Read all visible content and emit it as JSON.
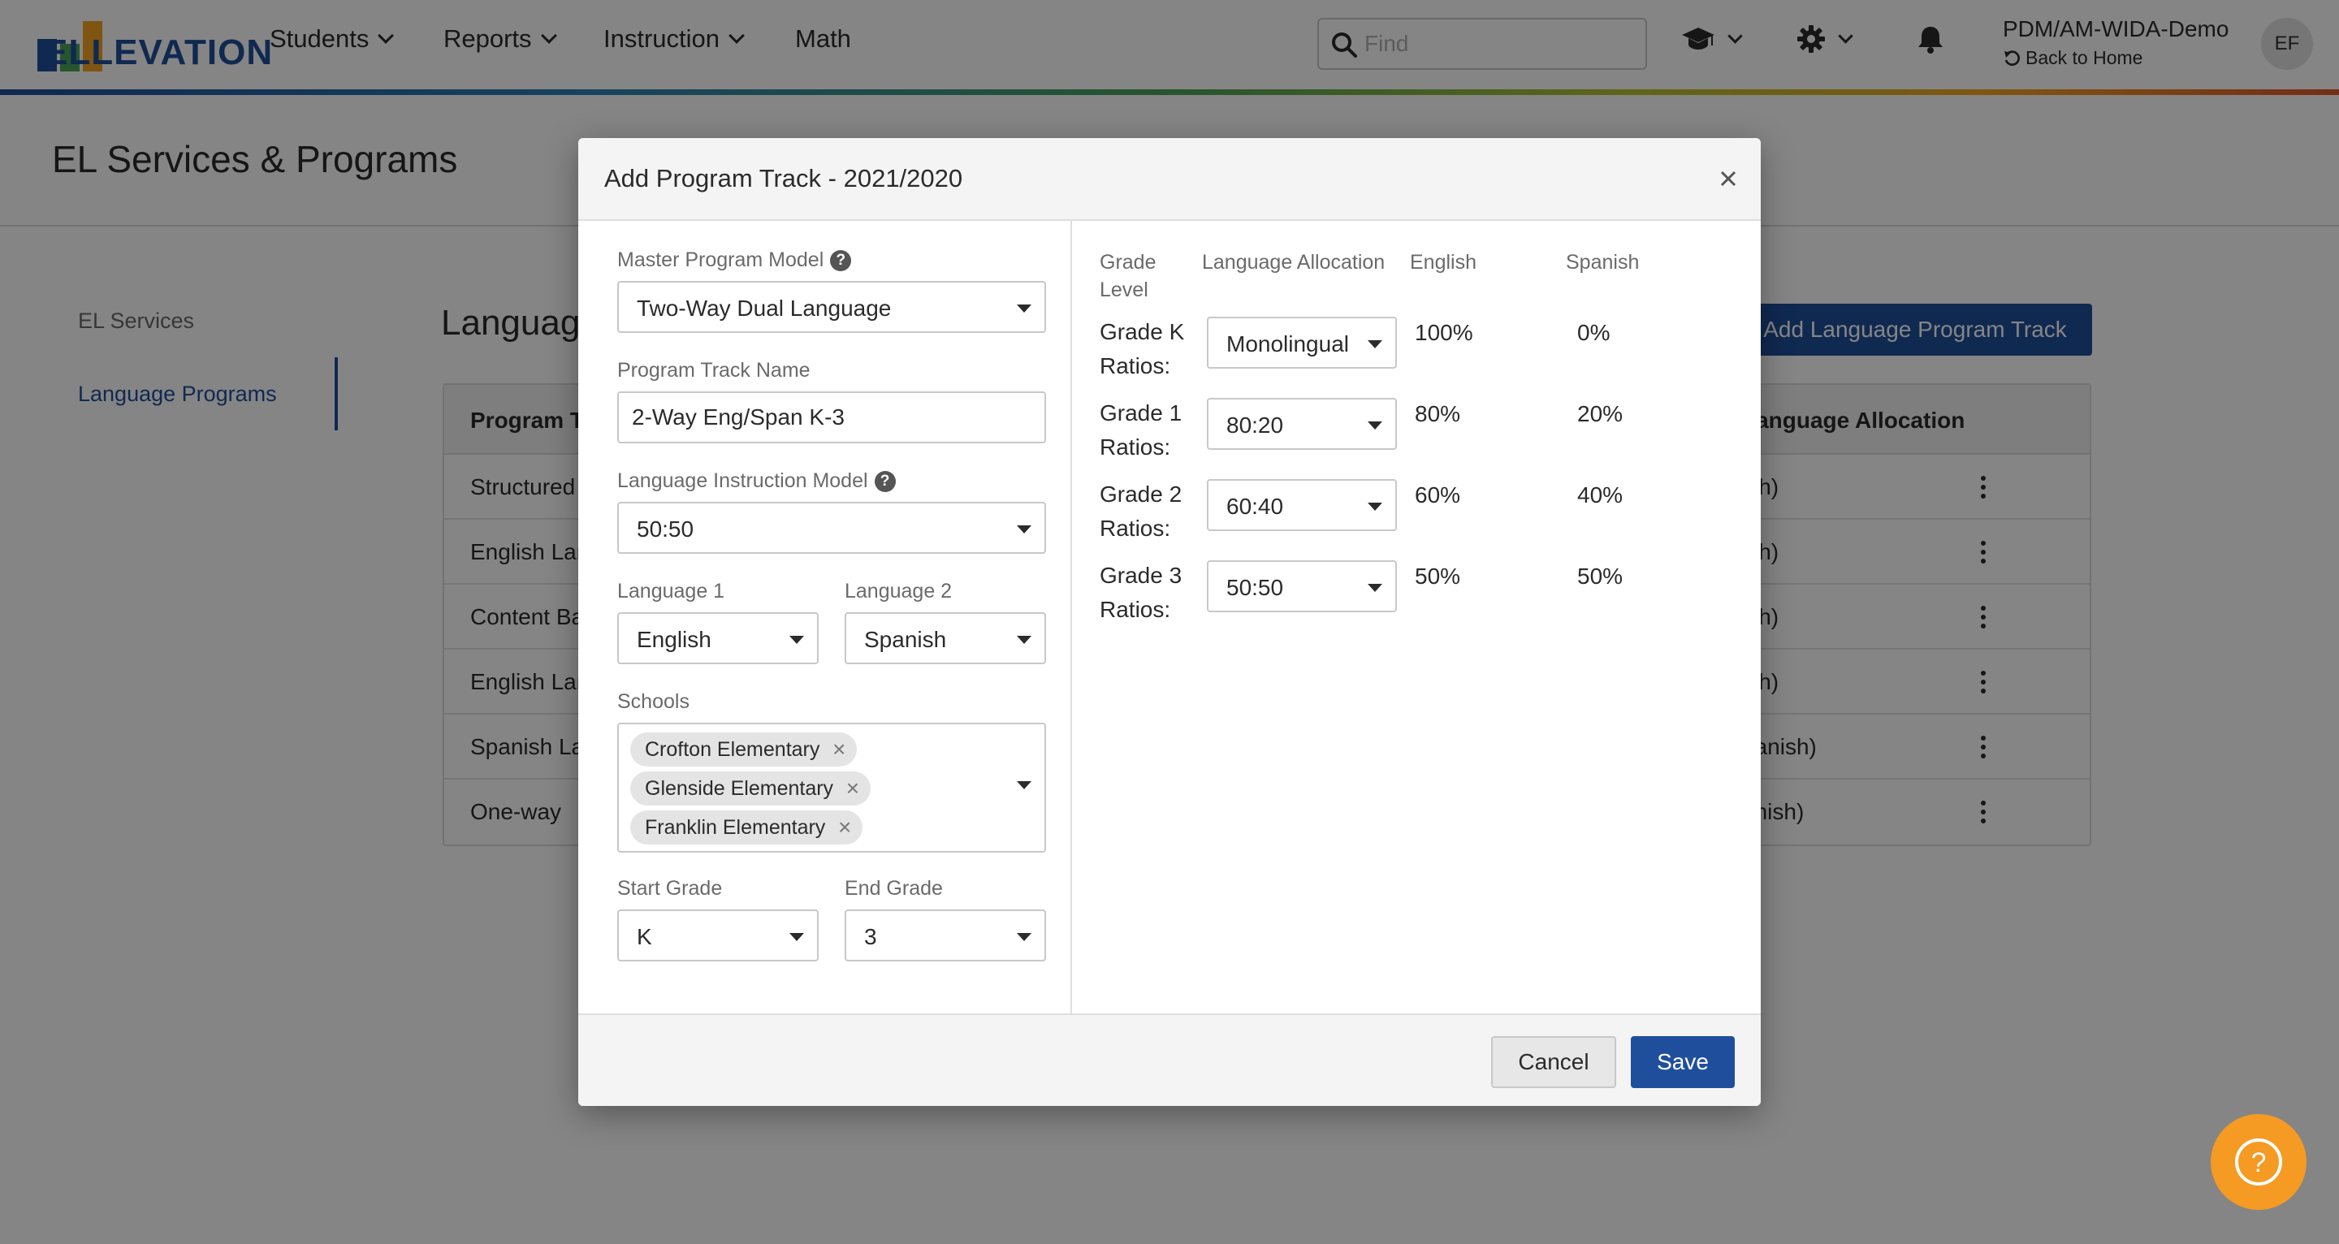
{
  "nav": {
    "logo_text": "ELLEVATION",
    "items": [
      {
        "label": "Students",
        "has_dropdown": true
      },
      {
        "label": "Reports",
        "has_dropdown": true
      },
      {
        "label": "Instruction",
        "has_dropdown": true
      },
      {
        "label": "Math",
        "has_dropdown": false
      }
    ],
    "search_placeholder": "Find",
    "user_org": "PDM/AM-WIDA-Demo",
    "back_home": "Back to Home",
    "avatar_initials": "EF",
    "icons": [
      "search-icon",
      "graduation-cap-icon",
      "gear-icon",
      "bell-icon",
      "undo-icon"
    ]
  },
  "page": {
    "title": "EL Services & Programs",
    "side_nav": [
      {
        "label": "EL Services",
        "active": false
      },
      {
        "label": "Language Programs",
        "active": true
      }
    ],
    "section_title": "Language Programs",
    "add_button": "Add Language Program Track",
    "table": {
      "headers": [
        "Program Track",
        "Language Allocation"
      ],
      "rows": [
        {
          "name": "Structured",
          "alloc": "ish)"
        },
        {
          "name": "English Lan",
          "alloc": "ish)"
        },
        {
          "name": "Content Ba",
          "alloc": "ish)"
        },
        {
          "name": "English Lan",
          "alloc": "ish)"
        },
        {
          "name": "Spanish La",
          "alloc": "panish)"
        },
        {
          "name": "One-way",
          "alloc": "anish)"
        }
      ]
    }
  },
  "modal": {
    "title": "Add Program Track - 2021/2020",
    "master_model_label": "Master Program Model",
    "master_model_value": "Two-Way Dual Language",
    "track_name_label": "Program Track Name",
    "track_name_value": "2-Way Eng/Span K-3",
    "instruction_model_label": "Language Instruction Model",
    "instruction_model_value": "50:50",
    "language1_label": "Language 1",
    "language1_value": "English",
    "language2_label": "Language 2",
    "language2_value": "Spanish",
    "schools_label": "Schools",
    "schools": [
      "Crofton Elementary",
      "Glenside Elementary",
      "Franklin Elementary"
    ],
    "start_grade_label": "Start Grade",
    "start_grade_value": "K",
    "end_grade_label": "End Grade",
    "end_grade_value": "3",
    "ratio_headers": {
      "grade_level": "Grade Level",
      "allocation": "Language Allocation",
      "english": "English",
      "spanish": "Spanish"
    },
    "ratios": [
      {
        "grade": "Grade K",
        "suffix": "Ratios:",
        "allocation": "Monolingual",
        "english": "100%",
        "spanish": "0%"
      },
      {
        "grade": "Grade 1",
        "suffix": "Ratios:",
        "allocation": "80:20",
        "english": "80%",
        "spanish": "20%"
      },
      {
        "grade": "Grade 2",
        "suffix": "Ratios:",
        "allocation": "60:40",
        "english": "60%",
        "spanish": "40%"
      },
      {
        "grade": "Grade 3",
        "suffix": "Ratios:",
        "allocation": "50:50",
        "english": "50%",
        "spanish": "50%"
      }
    ],
    "cancel_label": "Cancel",
    "save_label": "Save"
  },
  "colors": {
    "brand_blue": "#1f4f9c",
    "help_orange": "#f59a23",
    "overlay": "rgba(0,0,0,0.48)"
  }
}
